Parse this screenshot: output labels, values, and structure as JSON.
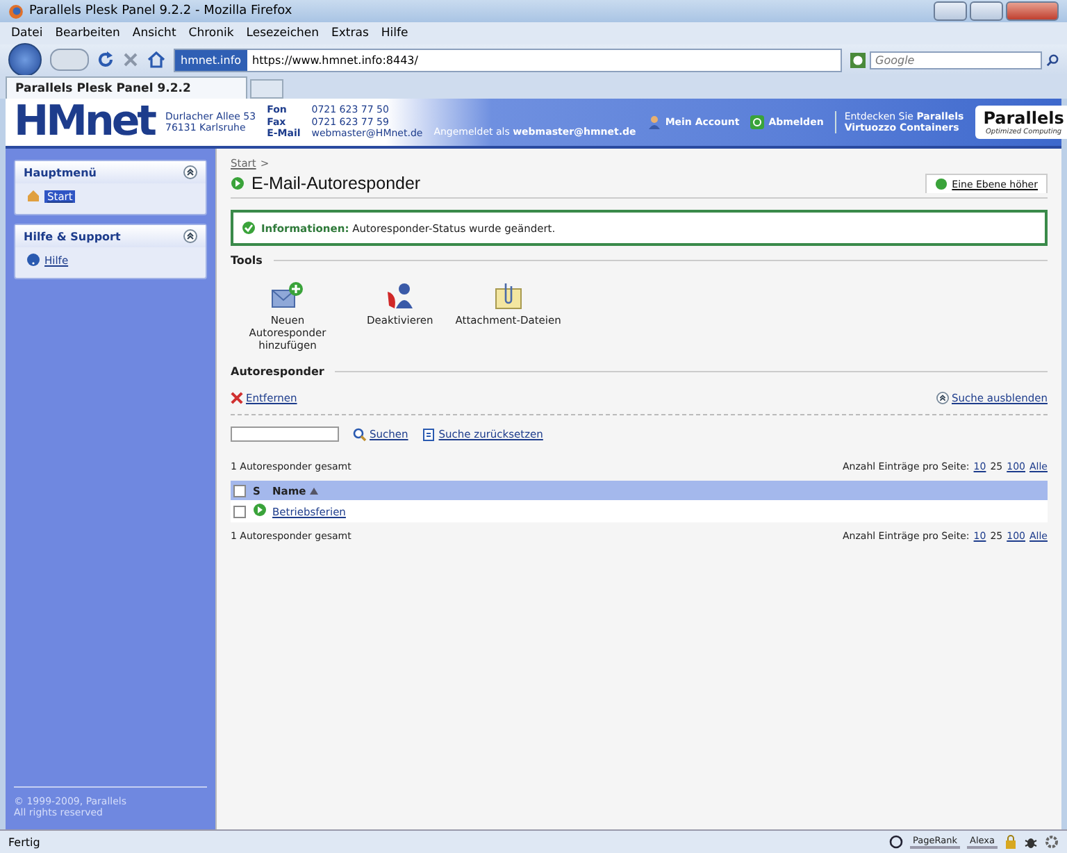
{
  "window": {
    "title": "Parallels Plesk Panel 9.2.2 - Mozilla Firefox"
  },
  "menu": [
    "Datei",
    "Bearbeiten",
    "Ansicht",
    "Chronik",
    "Lesezeichen",
    "Extras",
    "Hilfe"
  ],
  "navbar": {
    "site_badge": "hmnet.info",
    "url": "https://www.hmnet.info:8443/",
    "search_placeholder": "Google"
  },
  "tabs": [
    {
      "label": "Parallels Plesk Panel 9.2.2",
      "selected": true
    }
  ],
  "header": {
    "logo": "HMnet",
    "address": [
      "Durlacher Allee 53",
      "76131 Karlsruhe"
    ],
    "contacts": [
      {
        "label": "Fon",
        "value": "0721 623 77 50"
      },
      {
        "label": "Fax",
        "value": "0721 623 77 59"
      },
      {
        "label": "E-Mail",
        "value": "webmaster@HMnet.de"
      }
    ],
    "logged_in": "Angemeldet als **webmaster@hmnet.de**",
    "links": [
      "Mein Account",
      "Abmelden"
    ],
    "promo": [
      "Entdecken Sie **Parallels**",
      "**Virtuozzo Containers**"
    ],
    "brand": "Parallels",
    "brand_tagline": "Optimized Computing"
  },
  "sidebar": {
    "sections": [
      {
        "title": "Hauptmenü",
        "expanded": true,
        "items": [
          {
            "label": "Start",
            "selected": true
          }
        ]
      },
      {
        "title": "Hilfe & Support",
        "expanded": true,
        "items": [
          {
            "label": "Hilfe",
            "selected": false
          }
        ]
      }
    ],
    "footer": [
      "© 1999-2009, Parallels",
      "All rights reserved"
    ]
  },
  "content": {
    "breadcrumb": [
      "Start",
      ">"
    ],
    "title": "E-Mail-Autoresponder",
    "up_link": "Eine Ebene höher",
    "message": "**Informationen:** Autoresponder-Status wurde geändert.",
    "tools_title": "Tools",
    "tools": [
      {
        "kind": "add",
        "label": "Neuen Autoresponder hinzufügen"
      },
      {
        "kind": "disable",
        "label": "Deaktivieren"
      },
      {
        "kind": "attach",
        "label": "Attachment-Dateien"
      }
    ],
    "list_title": "Autoresponder",
    "remove": "Entfernen",
    "hide_search": "Suche ausblenden",
    "search_button": "Suchen",
    "reset_button": "Suche zurücksetzen",
    "summary_top": "1 Autoresponder gesamt",
    "summary_bottom": "1 Autoresponder gesamt",
    "pager_top": {
      "label": "Anzahl Einträge pro Seite:",
      "options": [
        {
          "label": "10",
          "selected": false
        },
        {
          "label": "25",
          "selected": true
        },
        {
          "label": "100",
          "selected": false
        },
        {
          "label": "Alle",
          "selected": false
        }
      ]
    },
    "pager_bottom": {
      "label": "Anzahl Einträge pro Seite:",
      "options": [
        {
          "label": "10",
          "selected": false
        },
        {
          "label": "25",
          "selected": true
        },
        {
          "label": "100",
          "selected": false
        },
        {
          "label": "Alle",
          "selected": false
        }
      ]
    },
    "select_all_checked": false,
    "columns": [
      "S",
      "Name"
    ],
    "rows": [
      {
        "name": "Betriebsferien",
        "checked": false,
        "active": true
      }
    ]
  },
  "status_bar": {
    "text": "Fertig",
    "widgets": [
      "PageRank",
      "Alexa"
    ]
  }
}
